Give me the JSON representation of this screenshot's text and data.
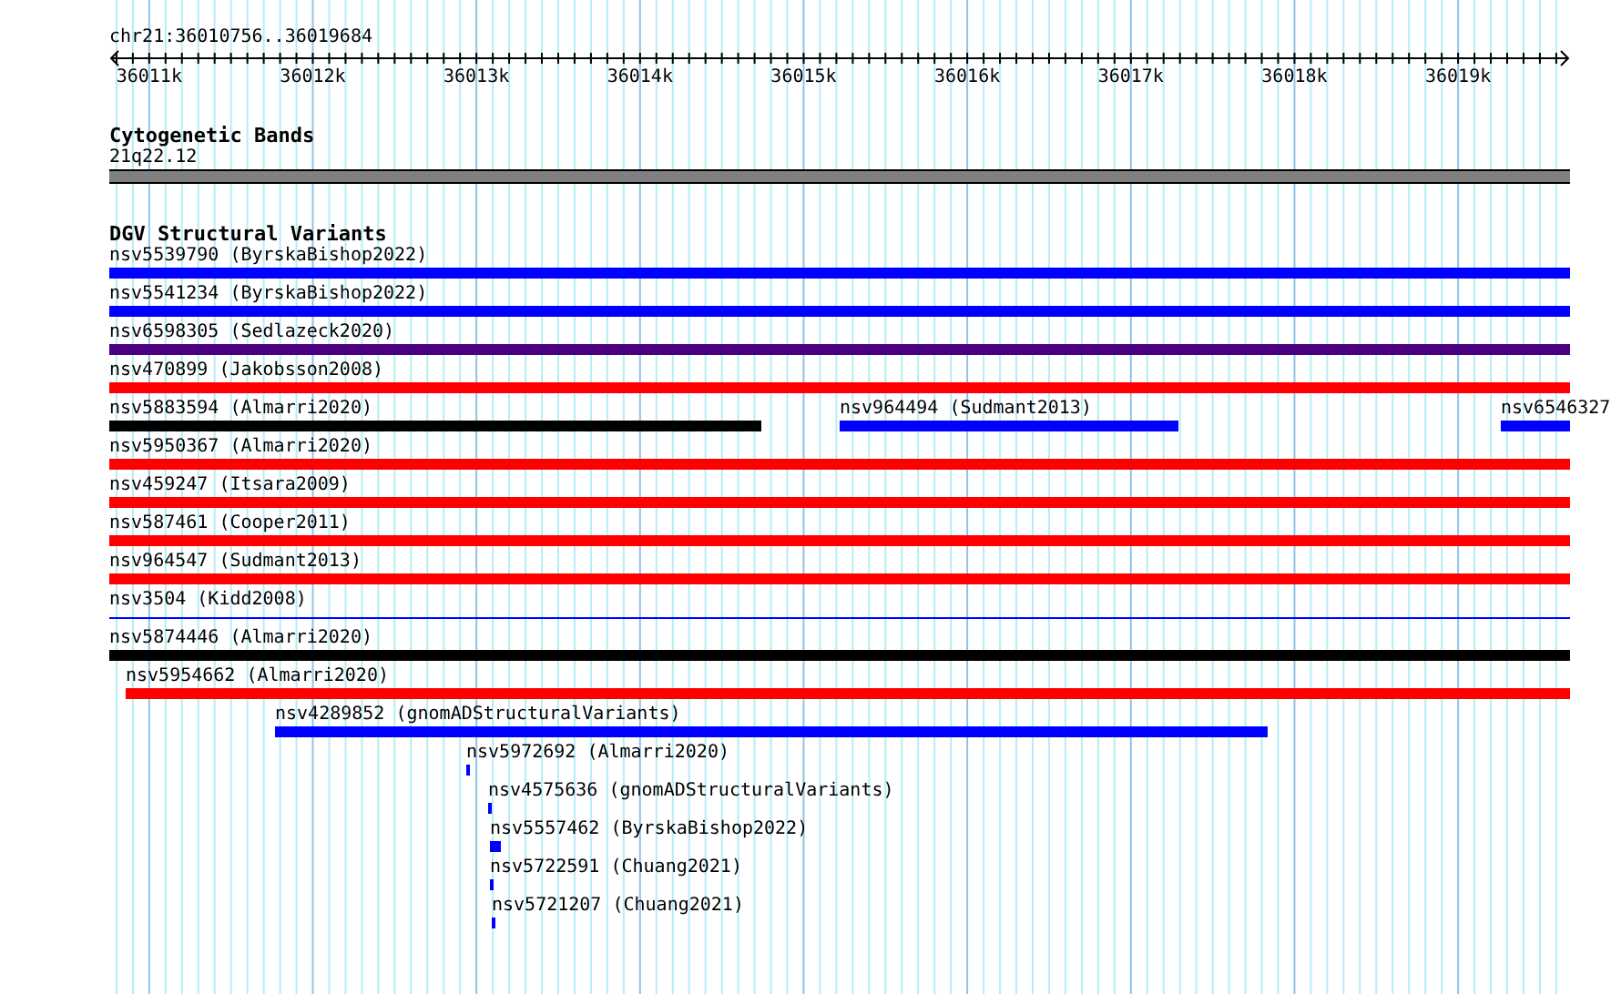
{
  "ruler": {
    "location": "chr21:36010756..36019684",
    "ticks": [
      "36011k",
      "36012k",
      "36013k",
      "36014k",
      "36015k",
      "36016k",
      "36017k",
      "36018k",
      "36019k"
    ]
  },
  "cytogenetic_bands": {
    "title": "Cytogenetic Bands",
    "band": "21q22.12"
  },
  "structural_variants": {
    "title": "DGV Structural Variants",
    "rows": [
      {
        "features": [
          {
            "label": "nsv5539790 (ByrskaBishop2022)",
            "color": "#0000ff",
            "kind": "bar"
          }
        ]
      },
      {
        "features": [
          {
            "label": "nsv5541234 (ByrskaBishop2022)",
            "color": "#0000ff",
            "kind": "bar"
          }
        ]
      },
      {
        "features": [
          {
            "label": "nsv6598305 (Sedlazeck2020)",
            "color": "#4b0082",
            "kind": "bar"
          }
        ]
      },
      {
        "features": [
          {
            "label": "nsv470899 (Jakobsson2008)",
            "color": "#ff0000",
            "kind": "bar"
          }
        ]
      },
      {
        "features": [
          {
            "label": "nsv5883594 (Almarri2020)",
            "color": "#000000",
            "kind": "bar"
          },
          {
            "label": "nsv964494 (Sudmant2013)",
            "color": "#0000ff",
            "kind": "bar"
          },
          {
            "label": "nsv6546327",
            "color": "#0000ff",
            "kind": "bar"
          }
        ]
      },
      {
        "features": [
          {
            "label": "nsv5950367 (Almarri2020)",
            "color": "#ff0000",
            "kind": "bar"
          }
        ]
      },
      {
        "features": [
          {
            "label": "nsv459247 (Itsara2009)",
            "color": "#ff0000",
            "kind": "bar"
          }
        ]
      },
      {
        "features": [
          {
            "label": "nsv587461 (Cooper2011)",
            "color": "#ff0000",
            "kind": "bar"
          }
        ]
      },
      {
        "features": [
          {
            "label": "nsv964547 (Sudmant2013)",
            "color": "#ff0000",
            "kind": "bar"
          }
        ]
      },
      {
        "features": [
          {
            "label": "nsv3504 (Kidd2008)",
            "color": "#0000ff",
            "kind": "line"
          }
        ]
      },
      {
        "features": [
          {
            "label": "nsv5874446 (Almarri2020)",
            "color": "#000000",
            "kind": "bar"
          }
        ]
      },
      {
        "features": [
          {
            "label": "nsv5954662 (Almarri2020)",
            "color": "#ff0000",
            "kind": "bar"
          }
        ]
      },
      {
        "features": [
          {
            "label": "nsv4289852 (gnomADStructuralVariants)",
            "color": "#0000ff",
            "kind": "bar"
          }
        ]
      },
      {
        "features": [
          {
            "label": "nsv5972692 (Almarri2020)",
            "color": "#0000ff",
            "kind": "bar"
          }
        ]
      },
      {
        "features": [
          {
            "label": "nsv4575636 (gnomADStructuralVariants)",
            "color": "#0000ff",
            "kind": "bar"
          }
        ]
      },
      {
        "features": [
          {
            "label": "nsv5557462 (ByrskaBishop2022)",
            "color": "#0000ff",
            "kind": "bar"
          }
        ]
      },
      {
        "features": [
          {
            "label": "nsv5722591 (Chuang2021)",
            "color": "#0000ff",
            "kind": "bar"
          }
        ]
      },
      {
        "features": [
          {
            "label": "nsv5721207 (Chuang2021)",
            "color": "#0000ff",
            "kind": "bar"
          }
        ]
      }
    ]
  }
}
